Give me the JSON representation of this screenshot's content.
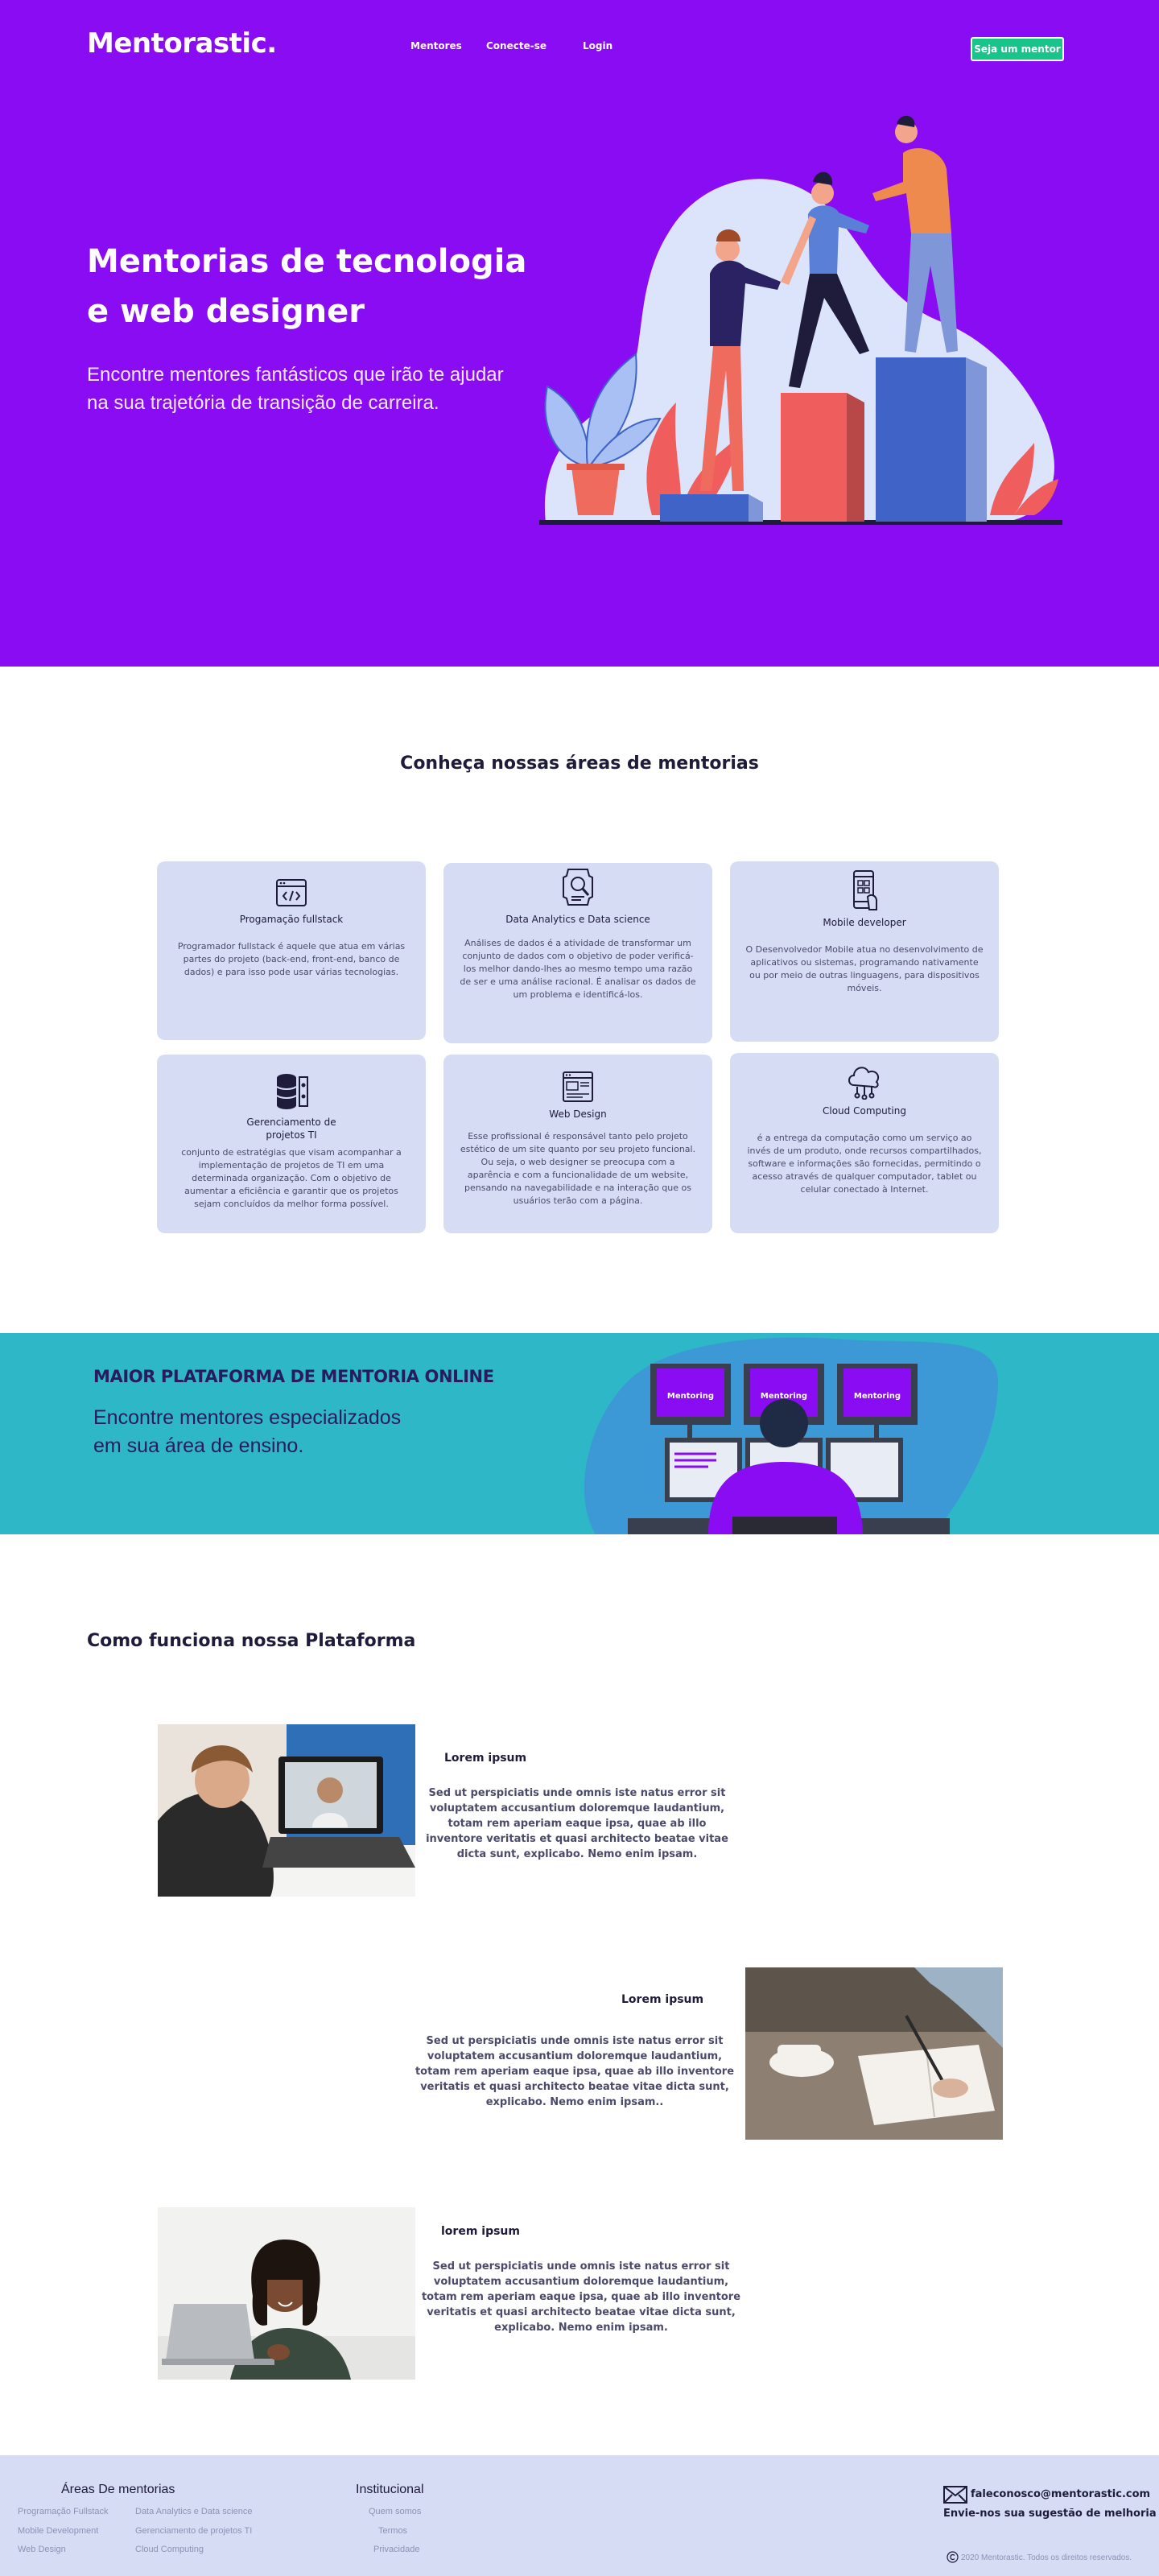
{
  "header": {
    "logo": "Mentorastic.",
    "nav": [
      "Mentores",
      "Conecte-se",
      "Login"
    ],
    "cta": "Seja um mentor"
  },
  "hero": {
    "title": "Mentorias de tecnologia e web designer",
    "subtitle": "Encontre mentores fantásticos que irão te ajudar na sua trajetória de transição de carreira."
  },
  "areas": {
    "title": "Conheça nossas áreas de mentorias",
    "cards": [
      {
        "icon": "code-window-icon",
        "title": "Progamação fullstack",
        "desc": "Programador fullstack é aquele que atua em várias partes do projeto (back-end, front-end, banco de dados) e para isso pode usar várias tecnologias."
      },
      {
        "icon": "data-analytics-icon",
        "title": "Data Analytics e Data science",
        "desc": "Análises de dados é a atividade de transformar um conjunto de dados com o objetivo de poder verificá-los melhor dando-lhes ao mesmo tempo uma razão de ser e uma análise racional. É analisar os dados de um problema e identificá-los."
      },
      {
        "icon": "mobile-phone-icon",
        "title": "Mobile developer",
        "desc": "O Desenvolvedor Mobile atua no desenvolvimento de aplicativos ou sistemas, programando nativamente ou por meio de outras linguagens, para dispositivos móveis."
      },
      {
        "icon": "database-settings-icon",
        "title": "Gerenciamento de projetos TI",
        "desc": "conjunto de estratégias que visam acompanhar a implementação de projetos de TI em uma determinada organização. Com o objetivo de aumentar a eficiência e garantir que os projetos sejam concluídos da melhor forma possível."
      },
      {
        "icon": "web-design-icon",
        "title": "Web Design",
        "desc": "Esse profissional é responsável tanto pelo projeto estético de um site quanto por seu projeto funcional. Ou seja, o web designer se preocupa com a aparência e com a funcionalidade de um website, pensando na navegabilidade e na interação que os usuários terão com a página."
      },
      {
        "icon": "cloud-computing-icon",
        "title": "Cloud Computing",
        "desc": "é a entrega da computação como um serviço ao invés de um produto, onde recursos compartilhados, software e informações são fornecidas, permitindo o acesso através de qualquer computador, tablet ou celular conectado à Internet."
      }
    ]
  },
  "banner": {
    "title": "MAIOR PLATAFORMA DE MENTORIA ONLINE",
    "subtitle": "Encontre mentores especializados em sua área de ensino.",
    "screen_label": "Mentoring"
  },
  "how": {
    "title": "Como funciona nossa Plataforma",
    "steps": [
      {
        "heading": "Lorem ipsum",
        "text": "Sed ut perspiciatis unde omnis iste natus error sit voluptatem accusantium doloremque laudantium, totam rem aperiam eaque ipsa, quae ab illo inventore veritatis et quasi architecto beatae vitae dicta sunt, explicabo. Nemo enim ipsam."
      },
      {
        "heading": "Lorem ipsum",
        "text": "Sed ut perspiciatis unde omnis iste natus error sit voluptatem accusantium doloremque laudantium, totam rem aperiam eaque ipsa, quae ab illo inventore veritatis et quasi architecto beatae vitae dicta sunt, explicabo. Nemo enim ipsam.."
      },
      {
        "heading": "lorem ipsum",
        "text": "Sed ut perspiciatis unde omnis iste natus error sit voluptatem accusantium doloremque laudantium, totam rem aperiam eaque ipsa, quae ab illo inventore veritatis et quasi architecto beatae vitae dicta sunt, explicabo. Nemo enim ipsam."
      }
    ]
  },
  "footer": {
    "areas_heading": "Áreas De mentorias",
    "areas_col1": [
      "Programação Fullstack",
      "Mobile Development",
      "Web Design"
    ],
    "areas_col2": [
      "Data Analytics e Data science",
      "Gerenciamento de projetos TI",
      "Cloud Computing"
    ],
    "inst_heading": "Institucional",
    "inst_links": [
      "Quem somos",
      "Termos",
      "Privacidade"
    ],
    "email": "faleconosco@mentorastic.com",
    "email_sub": "Envie-nos sua sugestão de melhoria",
    "copyright": "2020 Mentorastic. Todos os direitos reservados."
  },
  "colors": {
    "hero_bg": "#8a0cf3",
    "cta": "#19c48a",
    "card_bg": "#d5dcf4",
    "banner_bg": "#2eb7c6",
    "footer_bg": "#d5dcf4",
    "text_dark": "#1f1b3a"
  }
}
